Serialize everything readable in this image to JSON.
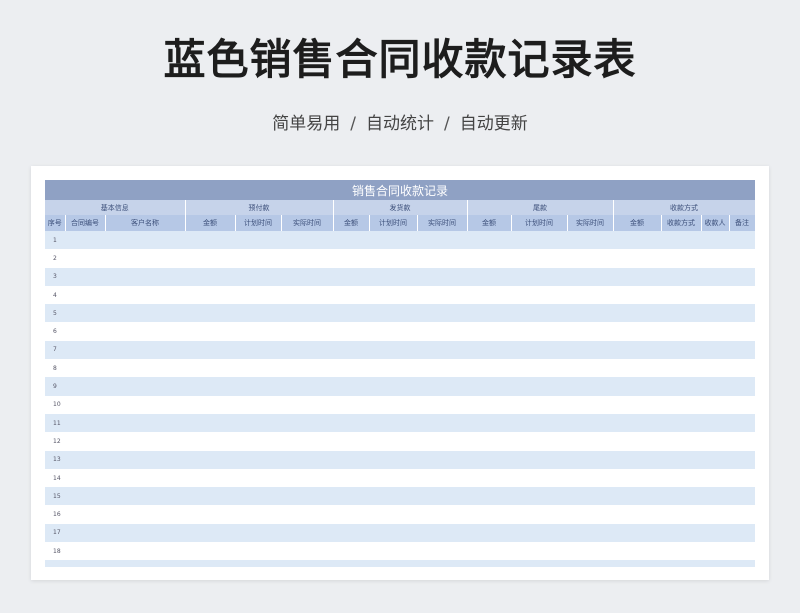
{
  "header": {
    "title": "蓝色销售合同收款记录表",
    "subtitle_parts": [
      "简单易用",
      "自动统计",
      "自动更新"
    ],
    "separator": "/"
  },
  "table": {
    "title": "销售合同收款记录",
    "groups": [
      {
        "label": "基本信息",
        "span": 3
      },
      {
        "label": "预付款",
        "span": 3
      },
      {
        "label": "发货款",
        "span": 3
      },
      {
        "label": "尾款",
        "span": 3
      },
      {
        "label": "收款方式",
        "span": 4
      }
    ],
    "columns": [
      "序号",
      "合同编号",
      "客户名称",
      "金额",
      "计划时间",
      "实际时间",
      "金额",
      "计划时间",
      "实际时间",
      "金额",
      "计划时间",
      "实际时间",
      "金额",
      "收款方式",
      "收款人",
      "备注"
    ],
    "rows": [
      "1",
      "2",
      "3",
      "4",
      "5",
      "6",
      "7",
      "8",
      "9",
      "10",
      "11",
      "12",
      "13",
      "14",
      "15",
      "16",
      "17",
      "18"
    ]
  },
  "colors": {
    "title_bar": "#8fa1c4",
    "group_header": "#c6d3ea",
    "column_header": "#b6c8e6",
    "stripe": "#dde9f6"
  }
}
